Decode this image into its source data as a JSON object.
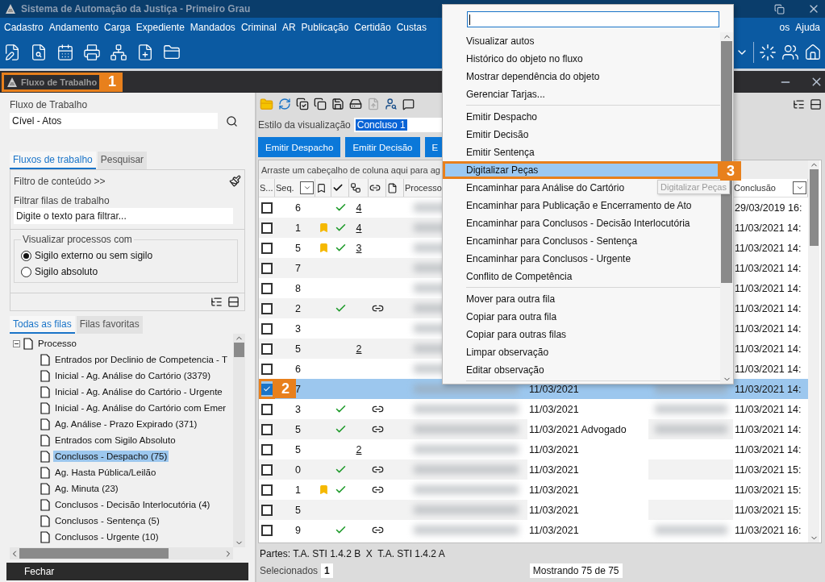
{
  "title_bar": {
    "title": "Sistema de Automação da Justiça - Primeiro Grau"
  },
  "menu_bar": {
    "items": [
      "Cadastro",
      "Andamento",
      "Carga",
      "Expediente",
      "Mandados",
      "Criminal",
      "AR",
      "Publicação",
      "Certidão",
      "Custas"
    ],
    "items_right": [
      "os",
      "Ajuda"
    ]
  },
  "panel_header": {
    "title": "Fluxo de Trabalho",
    "callout": "1"
  },
  "left": {
    "workflow_label": "Fluxo de Trabalho",
    "workflow_value": "Cível - Atos",
    "tabs": [
      {
        "label": "Fluxos de trabalho",
        "selected": true
      },
      {
        "label": "Pesquisar",
        "selected": false
      }
    ],
    "filter_toggle": "Filtro de conteúdo >>",
    "filter_label": "Filtrar filas de trabalho",
    "filter_placeholder": "Digite o texto para filtrar...",
    "visibility_legend": "Visualizar processos com",
    "radios": [
      {
        "label": "Sigilo externo ou sem sigilo",
        "selected": true
      },
      {
        "label": "Sigilo absoluto",
        "selected": false
      }
    ],
    "queue_tabs": [
      {
        "label": "Todas as filas",
        "selected": true
      },
      {
        "label": "Filas favoritas",
        "selected": false
      }
    ],
    "tree": [
      {
        "label": "Processo",
        "expanded": true,
        "selected": false,
        "children": [
          {
            "label": "Entrados por Declinio de Competencia - T",
            "selected": false
          },
          {
            "label": "Inicial - Ag. Análise do Cartório (3379)",
            "selected": false
          },
          {
            "label": "Inicial - Ag. Análise do Cartório - Urgente",
            "selected": false
          },
          {
            "label": "Inicial - Ag. Análise do Cartório com Emer",
            "selected": false
          },
          {
            "label": "Ag. Análise - Prazo Expirado (371)",
            "selected": false
          },
          {
            "label": "Entrados com Sigilo Absoluto",
            "selected": false
          },
          {
            "label": "Conclusos - Despacho (75)",
            "selected": true
          },
          {
            "label": "Ag. Hasta Pública/Leilão",
            "selected": false
          },
          {
            "label": "Ag. Minuta (23)",
            "selected": false
          },
          {
            "label": "Conclusos - Decisão Interlocutória (4)",
            "selected": false
          },
          {
            "label": "Conclusos - Sentença (5)",
            "selected": false
          },
          {
            "label": "Conclusos - Urgente (10)",
            "selected": false
          }
        ]
      }
    ],
    "close_button": "Fechar"
  },
  "right": {
    "view_style_label": "Estilo da visualização",
    "view_style_value": "Concluso 1",
    "buttons": [
      "Emitir Despacho",
      "Emitir Decisão",
      "E"
    ],
    "group_hint": "Arraste um cabeçalho de coluna aqui para ag",
    "columns": {
      "select": "S...",
      "seq": "Seq.",
      "process": "Processo",
      "conclusion": "Conclusão"
    },
    "rows": [
      {
        "checked": false,
        "selected": false,
        "seq": "6",
        "bookmark": false,
        "done": true,
        "count": "4",
        "linked": false,
        "column_8_blurred": false,
        "conclusion": "29/03/2019 16:"
      },
      {
        "checked": false,
        "selected": false,
        "seq": "1",
        "bookmark": true,
        "done": true,
        "count": "4",
        "linked": false,
        "column_8_blurred": false,
        "conclusion": "11/03/2021 14:"
      },
      {
        "checked": false,
        "selected": false,
        "seq": "5",
        "bookmark": true,
        "done": true,
        "count": "3",
        "linked": false,
        "column_8_blurred": false,
        "conclusion": "11/03/2021 14:"
      },
      {
        "checked": false,
        "selected": false,
        "seq": "7",
        "bookmark": false,
        "done": false,
        "linked": false,
        "column_8_blurred": false,
        "conclusion": "11/03/2021 14:"
      },
      {
        "checked": false,
        "selected": false,
        "seq": "8",
        "bookmark": false,
        "done": false,
        "linked": false,
        "column_8_blurred": false,
        "conclusion": "11/03/2021 14:"
      },
      {
        "checked": false,
        "selected": false,
        "seq": "2",
        "bookmark": false,
        "done": true,
        "linked": true,
        "column_8_blurred": false,
        "conclusion": "11/03/2021 14:"
      },
      {
        "checked": false,
        "selected": false,
        "seq": "3",
        "bookmark": false,
        "done": false,
        "linked": false,
        "column_8_blurred": false,
        "conclusion": "11/03/2021 14:"
      },
      {
        "checked": false,
        "selected": false,
        "seq": "5",
        "bookmark": false,
        "done": false,
        "count": "2",
        "linked": false,
        "column_8_blurred": false,
        "conclusion": "11/03/2021 14:"
      },
      {
        "checked": false,
        "selected": false,
        "seq": "6",
        "bookmark": false,
        "done": false,
        "linked": false,
        "column_8_blurred": false,
        "conclusion": "11/03/2021 14:"
      },
      {
        "checked": true,
        "selected": true,
        "callout": "2",
        "seq": "7",
        "bookmark": false,
        "done": false,
        "linked": false,
        "column_7": "11/03/2021",
        "column_8_blurred": true,
        "conclusion": "11/03/2021 14:"
      },
      {
        "checked": false,
        "selected": false,
        "seq": "3",
        "bookmark": false,
        "done": true,
        "linked": true,
        "column_7": "11/03/2021",
        "column_8_blurred": true,
        "conclusion": "11/03/2021 14:"
      },
      {
        "checked": false,
        "selected": false,
        "seq": "5",
        "bookmark": false,
        "done": true,
        "linked": true,
        "column_7": "11/03/2021 Advogado",
        "column_8_blurred": true,
        "conclusion": "11/03/2021 14:"
      },
      {
        "checked": false,
        "selected": false,
        "seq": "5",
        "bookmark": false,
        "done": false,
        "count": "2",
        "linked": false,
        "column_7": "11/03/2021",
        "column_8_blurred": false,
        "conclusion": "11/03/2021 14:"
      },
      {
        "checked": false,
        "selected": false,
        "seq": "0",
        "bookmark": false,
        "done": true,
        "linked": true,
        "column_7": "11/03/2021",
        "column_8_blurred": false,
        "conclusion": "11/03/2021 15:"
      },
      {
        "checked": false,
        "selected": false,
        "seq": "1",
        "bookmark": true,
        "done": true,
        "linked": true,
        "column_7": "11/03/2021",
        "column_8_blurred": false,
        "conclusion": "11/03/2021 15:"
      },
      {
        "checked": false,
        "selected": false,
        "seq": "5",
        "bookmark": false,
        "done": false,
        "linked": false,
        "column_7": "11/03/2021",
        "column_8_blurred": false,
        "conclusion": "11/03/2021 15:"
      },
      {
        "checked": false,
        "selected": false,
        "seq": "9",
        "bookmark": false,
        "done": true,
        "linked": true,
        "column_7": "11/03/2021",
        "column_8_blurred": true,
        "conclusion": "11/03/2021 16:"
      }
    ],
    "parts": "Partes: T.A. STI 1.4.2 B  X  T.A. STI 1.4.2 A",
    "selected_label": "Selecionados",
    "selected_count": "1",
    "showing": "Mostrando 75 de 75"
  },
  "context_menu": {
    "groups": [
      [
        {
          "label": "Visualizar autos",
          "selected": false
        },
        {
          "label": "Histórico do objeto no fluxo",
          "selected": false
        },
        {
          "label": "Mostrar dependência do objeto",
          "selected": false
        },
        {
          "label": "Gerenciar Tarjas...",
          "selected": false
        }
      ],
      [
        {
          "label": "Emitir Despacho",
          "selected": false
        },
        {
          "label": "Emitir Decisão",
          "selected": false
        },
        {
          "label": "Emitir Sentença",
          "selected": false
        },
        {
          "label": "Digitalizar Peças",
          "selected": true,
          "callout": "3"
        },
        {
          "label": "Encaminhar para Análise do Cartório",
          "selected": false
        },
        {
          "label": "Encaminhar para Publicação e Encerramento de Ato",
          "selected": false
        },
        {
          "label": "Encaminhar para Conclusos - Decisão Interlocutória",
          "selected": false
        },
        {
          "label": "Encaminhar para Conclusos - Sentença",
          "selected": false
        },
        {
          "label": "Encaminhar para Conclusos - Urgente",
          "selected": false
        },
        {
          "label": "Conflito de Competência",
          "selected": false
        }
      ],
      [
        {
          "label": "Mover para outra fila",
          "selected": false
        },
        {
          "label": "Copiar para outra fila",
          "selected": false
        },
        {
          "label": "Copiar para outras filas",
          "selected": false
        },
        {
          "label": "Limpar observação",
          "selected": false
        },
        {
          "label": "Editar observação",
          "selected": false
        }
      ]
    ]
  },
  "tooltip": "Digitalizar Peças"
}
